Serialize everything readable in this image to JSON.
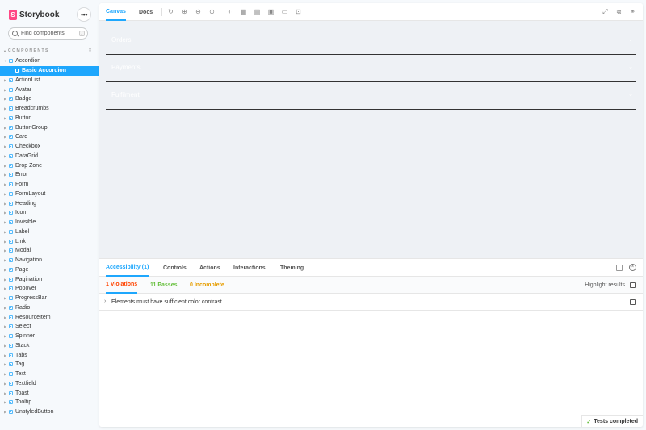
{
  "sidebar": {
    "brand": "Storybook",
    "brand_letter": "S",
    "menu_label": "•••",
    "search_placeholder": "Find components",
    "search_shortcut": "/",
    "section_label": "COMPONENTS",
    "items": [
      {
        "label": "Accordion",
        "expanded": true
      },
      {
        "label": "Basic Accordion",
        "story": true,
        "selected": true
      },
      {
        "label": "ActionList"
      },
      {
        "label": "Avatar"
      },
      {
        "label": "Badge"
      },
      {
        "label": "Breadcrumbs"
      },
      {
        "label": "Button"
      },
      {
        "label": "ButtonGroup"
      },
      {
        "label": "Card"
      },
      {
        "label": "Checkbox"
      },
      {
        "label": "DataGrid"
      },
      {
        "label": "Drop Zone"
      },
      {
        "label": "Error"
      },
      {
        "label": "Form"
      },
      {
        "label": "FormLayout"
      },
      {
        "label": "Heading"
      },
      {
        "label": "Icon"
      },
      {
        "label": "Invisible"
      },
      {
        "label": "Label"
      },
      {
        "label": "Link"
      },
      {
        "label": "Modal"
      },
      {
        "label": "Navigation"
      },
      {
        "label": "Page"
      },
      {
        "label": "Pagination"
      },
      {
        "label": "Popover"
      },
      {
        "label": "ProgressBar"
      },
      {
        "label": "Radio"
      },
      {
        "label": "ResourceItem"
      },
      {
        "label": "Select"
      },
      {
        "label": "Spinner"
      },
      {
        "label": "Stack"
      },
      {
        "label": "Tabs"
      },
      {
        "label": "Tag"
      },
      {
        "label": "Text"
      },
      {
        "label": "Textfield"
      },
      {
        "label": "Toast"
      },
      {
        "label": "Tooltip"
      },
      {
        "label": "UnstyledButton"
      }
    ]
  },
  "toolbar": {
    "tabs": [
      {
        "label": "Canvas",
        "active": true
      },
      {
        "label": "Docs",
        "active": false
      }
    ],
    "tools": [
      "reload-icon",
      "zoom-in-icon",
      "zoom-out-icon",
      "zoom-reset-icon",
      "background-icon",
      "grid-icon",
      "viewport-icon",
      "measure-icon",
      "outline-icon",
      "rulers-icon"
    ],
    "right_tools": [
      "fullscreen-icon",
      "open-new-tab-icon",
      "copy-link-icon"
    ]
  },
  "canvas": {
    "accordion_items": [
      "Orders",
      "Payments",
      "Fulfilment"
    ]
  },
  "addons": {
    "tabs": [
      {
        "label": "Accessibility (1)",
        "active": true
      },
      {
        "label": "Controls"
      },
      {
        "label": "Actions"
      },
      {
        "label": "Interactions"
      },
      {
        "label": "Theming"
      }
    ],
    "results": {
      "violations": "1 Violations",
      "passes": "11 Passes",
      "incomplete": "0 Incomplete"
    },
    "highlight_label": "Highlight results",
    "violation": "Elements must have sufficient color contrast",
    "status": "Tests completed"
  },
  "colors": {
    "accent": "#1ea7fd",
    "brand": "#ff4785",
    "violation": "#ff4400",
    "pass": "#66bf3c",
    "incomplete": "#e69d00"
  }
}
